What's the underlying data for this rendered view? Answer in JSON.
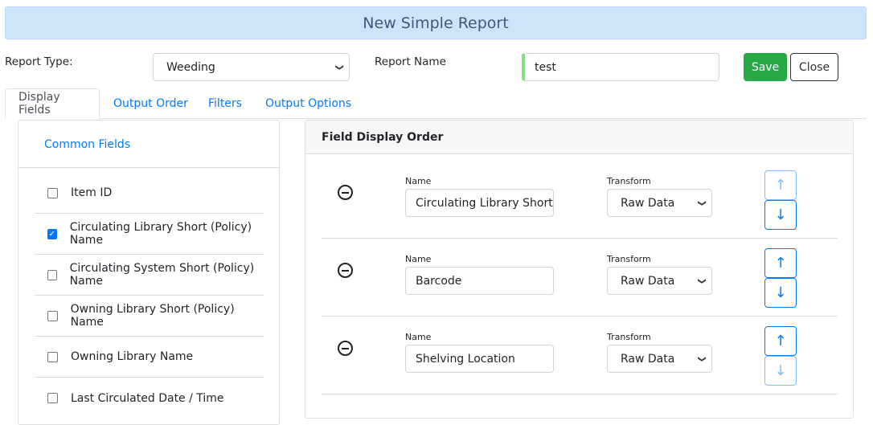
{
  "header": {
    "title": "New Simple Report"
  },
  "form": {
    "report_type_label": "Report Type:",
    "report_type_value": "Weeding",
    "report_name_label": "Report Name",
    "report_name_value": "test",
    "save_label": "Save",
    "close_label": "Close"
  },
  "tabs": [
    {
      "label": "Display Fields",
      "active": true
    },
    {
      "label": "Output Order"
    },
    {
      "label": "Filters"
    },
    {
      "label": "Output Options"
    }
  ],
  "left_panel": {
    "title": "Common Fields",
    "items": [
      {
        "label": "Item ID",
        "checked": false
      },
      {
        "label": "Circulating Library Short (Policy) Name",
        "checked": true
      },
      {
        "label": "Circulating System Short (Policy) Name",
        "checked": false
      },
      {
        "label": "Owning Library Short (Policy) Name",
        "checked": false
      },
      {
        "label": "Owning Library Name",
        "checked": false
      },
      {
        "label": "Last Circulated Date / Time",
        "checked": false
      }
    ]
  },
  "right_panel": {
    "title": "Field Display Order",
    "name_label": "Name",
    "transform_label": "Transform",
    "rows": [
      {
        "name": "Circulating Library Short (",
        "transform": "Raw Data"
      },
      {
        "name": "Barcode",
        "transform": "Raw Data"
      },
      {
        "name": "Shelving Location",
        "transform": "Raw Data"
      }
    ]
  },
  "colors": {
    "save": "#28a745",
    "header_bg": "#cce5fb",
    "link": "#007bff",
    "input_valid": "#7ee07e"
  }
}
